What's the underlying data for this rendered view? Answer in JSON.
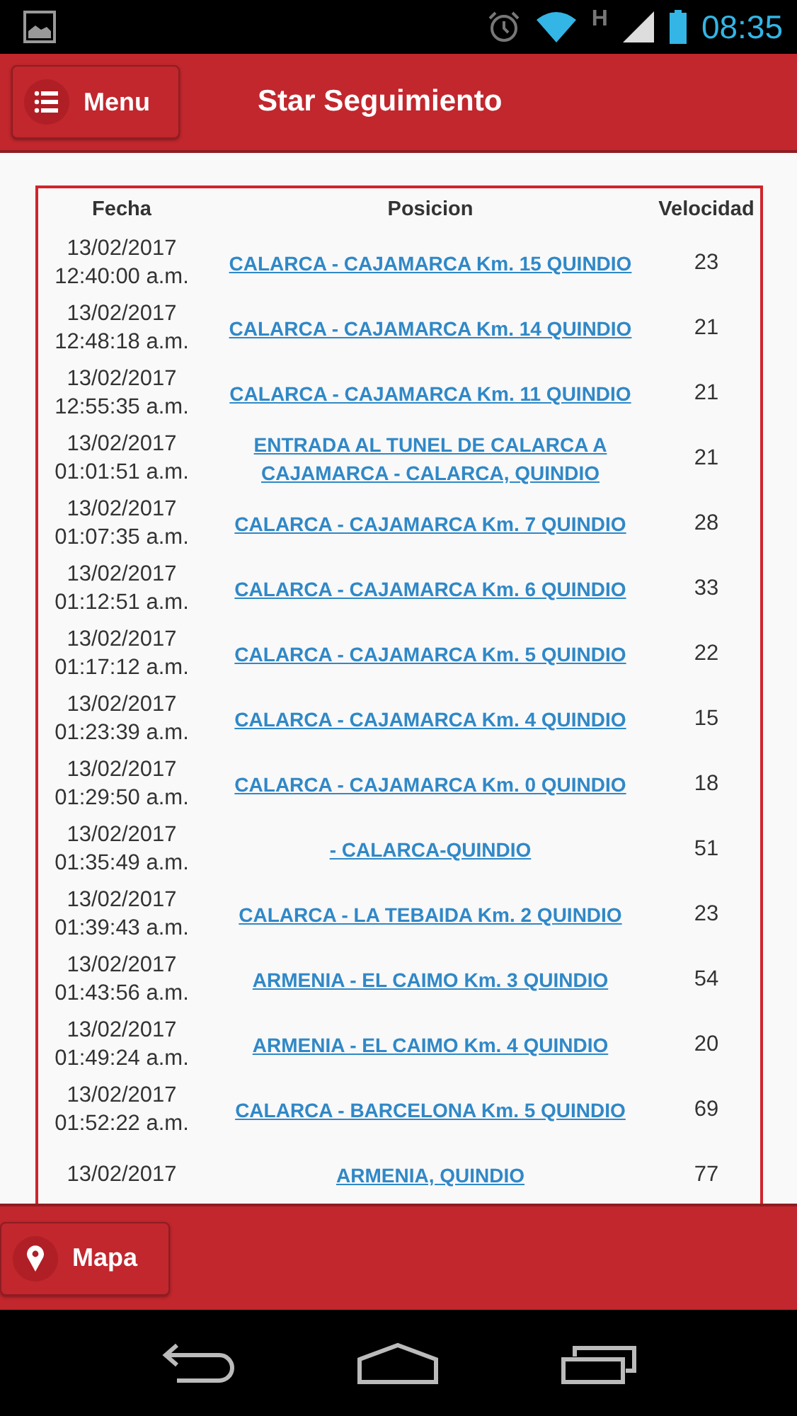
{
  "status_bar": {
    "network": "H",
    "time": "08:35"
  },
  "header": {
    "menu_button": "Menu",
    "title": "Star Seguimiento"
  },
  "table": {
    "columns": [
      "Fecha",
      "Posicion",
      "Velocidad"
    ],
    "rows": [
      {
        "date": "13/02/2017",
        "time": "12:40:00 a.m.",
        "position": "CALARCA - CAJAMARCA Km. 15 QUINDIO",
        "speed": "23"
      },
      {
        "date": "13/02/2017",
        "time": "12:48:18 a.m.",
        "position": "CALARCA - CAJAMARCA Km. 14 QUINDIO",
        "speed": "21"
      },
      {
        "date": "13/02/2017",
        "time": "12:55:35 a.m.",
        "position": "CALARCA - CAJAMARCA Km. 11 QUINDIO",
        "speed": "21"
      },
      {
        "date": "13/02/2017",
        "time": "01:01:51 a.m.",
        "position": "ENTRADA AL TUNEL DE CALARCA A CAJAMARCA - CALARCA, QUINDIO",
        "speed": "21"
      },
      {
        "date": "13/02/2017",
        "time": "01:07:35 a.m.",
        "position": "CALARCA - CAJAMARCA Km. 7 QUINDIO",
        "speed": "28"
      },
      {
        "date": "13/02/2017",
        "time": "01:12:51 a.m.",
        "position": "CALARCA - CAJAMARCA Km. 6 QUINDIO",
        "speed": "33"
      },
      {
        "date": "13/02/2017",
        "time": "01:17:12 a.m.",
        "position": "CALARCA - CAJAMARCA Km. 5 QUINDIO",
        "speed": "22"
      },
      {
        "date": "13/02/2017",
        "time": "01:23:39 a.m.",
        "position": "CALARCA - CAJAMARCA Km. 4 QUINDIO",
        "speed": "15"
      },
      {
        "date": "13/02/2017",
        "time": "01:29:50 a.m.",
        "position": "CALARCA - CAJAMARCA Km. 0 QUINDIO",
        "speed": "18"
      },
      {
        "date": "13/02/2017",
        "time": "01:35:49 a.m.",
        "position": "- CALARCA-QUINDIO",
        "speed": "51"
      },
      {
        "date": "13/02/2017",
        "time": "01:39:43 a.m.",
        "position": "CALARCA - LA TEBAIDA Km. 2 QUINDIO",
        "speed": "23"
      },
      {
        "date": "13/02/2017",
        "time": "01:43:56 a.m.",
        "position": "ARMENIA - EL CAIMO Km. 3 QUINDIO",
        "speed": "54"
      },
      {
        "date": "13/02/2017",
        "time": "01:49:24 a.m.",
        "position": "ARMENIA - EL CAIMO Km. 4 QUINDIO",
        "speed": "20"
      },
      {
        "date": "13/02/2017",
        "time": "01:52:22 a.m.",
        "position": "CALARCA - BARCELONA Km. 5 QUINDIO",
        "speed": "69"
      },
      {
        "date": "13/02/2017",
        "position": "ARMENIA, QUINDIO",
        "speed": "77"
      }
    ]
  },
  "footer": {
    "map_button": "Mapa"
  }
}
